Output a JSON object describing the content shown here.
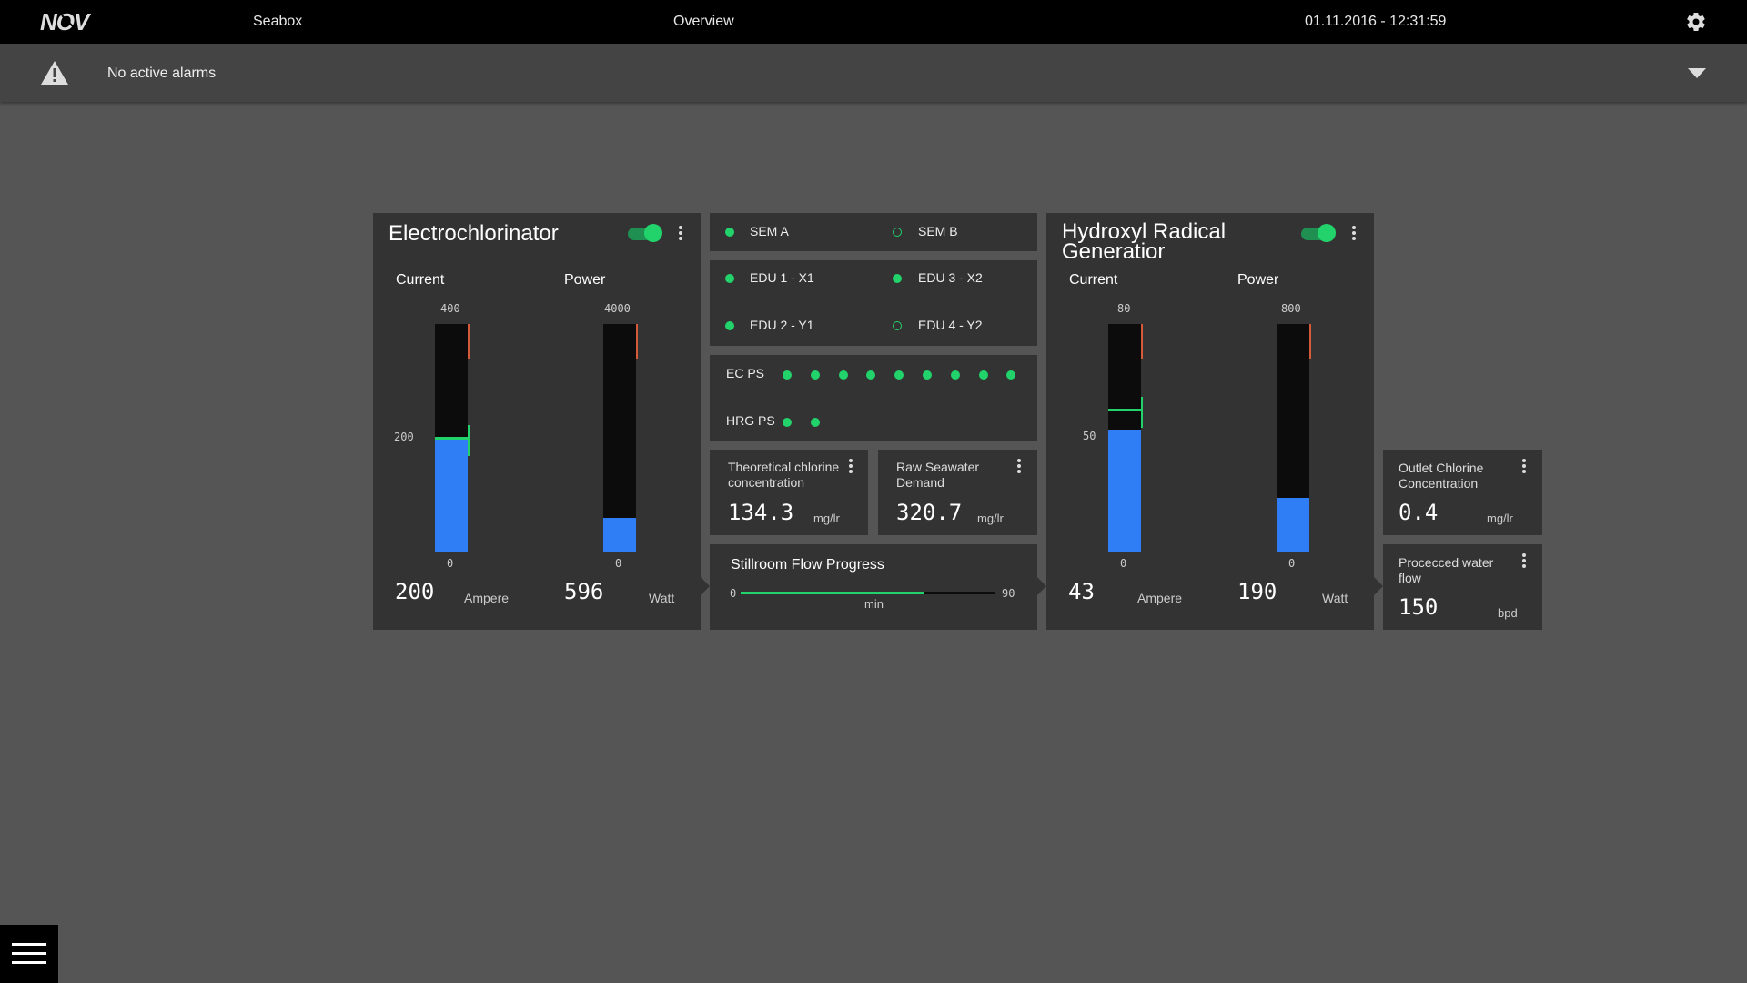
{
  "topbar": {
    "brand": "NOV",
    "app_name": "Seabox",
    "view_title": "Overview",
    "datetime": "01.11.2016 - 12:31:59",
    "settings_icon": "gear-icon"
  },
  "alarms": {
    "icon": "warning-icon",
    "text": "No active alarms",
    "expand_icon": "chevron-down-icon"
  },
  "electrochlorinator": {
    "title": "Electrochlorinator",
    "enabled": true,
    "current": {
      "label": "Current",
      "max_label": "400",
      "mid_label": "200",
      "min_label": "0",
      "max": 400,
      "value": 200,
      "setpoint": 200,
      "value_text": "200",
      "unit": "Ampere"
    },
    "power": {
      "label": "Power",
      "max_label": "4000",
      "min_label": "0",
      "max": 4000,
      "value": 596,
      "value_text": "596",
      "unit": "Watt"
    }
  },
  "status": {
    "sem": [
      {
        "label": "SEM A",
        "active": true
      },
      {
        "label": "SEM B",
        "active": false
      }
    ],
    "edu": [
      {
        "label": "EDU 1 - X1",
        "active": true
      },
      {
        "label": "EDU 3 - X2",
        "active": true
      },
      {
        "label": "EDU 2 - Y1",
        "active": true
      },
      {
        "label": "EDU 4 - Y2",
        "active": false
      }
    ],
    "ec_ps": {
      "label": "EC PS",
      "count": 9
    },
    "hrg_ps": {
      "label": "HRG PS",
      "count": 2
    }
  },
  "theoretical_chlorine": {
    "title": "Theoretical chlorine concentration",
    "value": "134.3",
    "unit": "mg/lr"
  },
  "raw_seawater": {
    "title": "Raw Seawater Demand",
    "value": "320.7",
    "unit": "mg/lr"
  },
  "stillroom_flow": {
    "title": "Stillroom Flow Progress",
    "min_label": "0",
    "max_label": "90",
    "unit": "min",
    "progress": 0.72
  },
  "hydroxyl": {
    "title": "Hydroxyl Radical Generatior",
    "enabled": true,
    "current": {
      "label": "Current",
      "max_label": "80",
      "mid_label": "50",
      "min_label": "0",
      "max": 80,
      "value": 43,
      "setpoint": 50,
      "value_text": "43",
      "unit": "Ampere"
    },
    "power": {
      "label": "Power",
      "max_label": "800",
      "min_label": "0",
      "max": 800,
      "value": 190,
      "value_text": "190",
      "unit": "Watt"
    }
  },
  "outlet_chlorine": {
    "title": "Outlet Chlorine Concentration",
    "value": "0.4",
    "unit": "mg/lr"
  },
  "processed_water": {
    "title": "Procecced water flow",
    "value": "150",
    "unit": "bpd"
  },
  "menu": {
    "icon": "hamburger-menu-icon"
  },
  "colors": {
    "accent_green": "#21d36a",
    "bar_blue": "#2f7ef6",
    "limit_red": "#d55a3a",
    "card_bg": "#333333",
    "page_bg": "#555555"
  }
}
